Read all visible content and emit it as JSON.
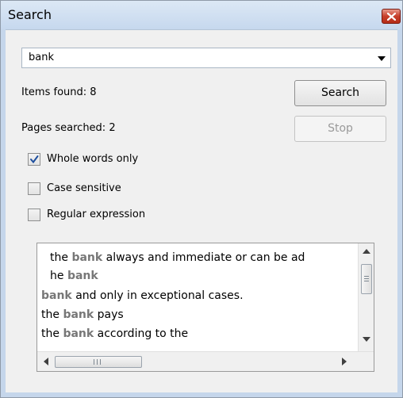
{
  "window": {
    "title": "Search",
    "close_icon": "close-icon"
  },
  "search": {
    "query": "bank"
  },
  "stats": {
    "items_found_label": "Items found:",
    "items_found_value": "8",
    "pages_searched_label": "Pages searched:",
    "pages_searched_value": "2"
  },
  "buttons": {
    "search_label": "Search",
    "stop_label": "Stop"
  },
  "options": {
    "whole_words": {
      "label": "Whole words only",
      "checked": true
    },
    "case_sensitive": {
      "label": "Case sensitive",
      "checked": false
    },
    "regex": {
      "label": "Regular expression",
      "checked": false
    }
  },
  "results": [
    {
      "before": "the ",
      "match": "bank",
      "after": " always and immediate or can be ad"
    },
    {
      "before": "he ",
      "match": "bank",
      "after": ""
    },
    {
      "before": "",
      "match": "bank",
      "after": " and only in exceptional cases."
    },
    {
      "before": "the ",
      "match": "bank",
      "after": " pays"
    },
    {
      "before": "the ",
      "match": "bank",
      "after": " according to the"
    }
  ],
  "colors": {
    "highlight": "#777777",
    "close_button": "#c73f2b"
  },
  "icons": {
    "dropdown": "chevron-down-icon",
    "check": "checkmark-icon",
    "scroll_up": "arrow-up-icon",
    "scroll_down": "arrow-down-icon",
    "scroll_left": "arrow-left-icon",
    "scroll_right": "arrow-right-icon",
    "grip": "grip-icon"
  }
}
